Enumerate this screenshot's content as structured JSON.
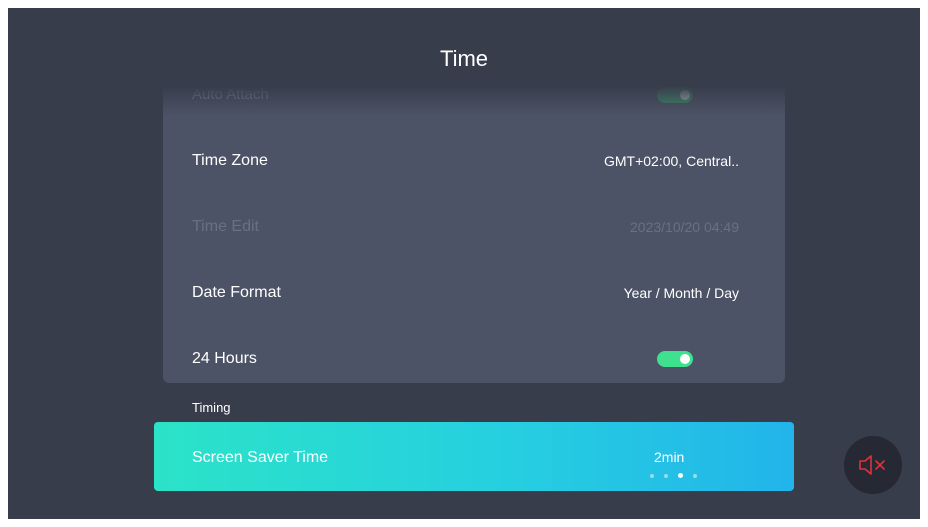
{
  "header": {
    "title": "Time"
  },
  "settings": {
    "auto_attach": {
      "label": "Auto Attach",
      "enabled": true
    },
    "time_zone": {
      "label": "Time Zone",
      "value": "GMT+02:00, Central.."
    },
    "time_edit": {
      "label": "Time Edit",
      "value": "2023/10/20 04:49",
      "disabled": true
    },
    "date_format": {
      "label": "Date Format",
      "value": "Year / Month / Day"
    },
    "hours24": {
      "label": "24 Hours",
      "enabled": true
    }
  },
  "timing": {
    "section_label": "Timing",
    "screen_saver": {
      "label": "Screen Saver Time",
      "value": "2min",
      "page_count": 4,
      "active_page": 3
    }
  },
  "mute": {
    "icon": "speaker-muted-icon",
    "color": "#e0313a"
  },
  "colors": {
    "background": "#383d4c",
    "card": "#4d5366",
    "toggle_on": "#3fe08e",
    "highlight_start": "#2be3c8",
    "highlight_end": "#22b4ea"
  }
}
